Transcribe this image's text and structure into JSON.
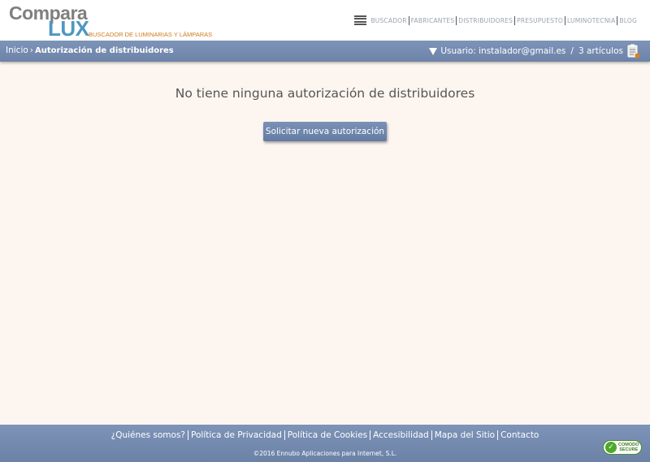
{
  "header": {
    "logo": {
      "compara": "Compara",
      "lux": "LUX",
      "tagline": "BUSCADOR DE LUMINARIAS Y LÁMPARAS"
    },
    "nav": [
      {
        "label": "BUSCADOR"
      },
      {
        "label": "FABRICANTES"
      },
      {
        "label": "DISTRIBUIDORES"
      },
      {
        "label": "PRESUPUESTO"
      },
      {
        "label": "LUMINOTECNIA"
      },
      {
        "label": "BLOG"
      }
    ],
    "menu_icon": "hamburger-menu-icon"
  },
  "bar": {
    "breadcrumb": {
      "home": "Inicio",
      "separator": "›",
      "current": "Autorización de distribuidores"
    },
    "user": {
      "label": "Usuario: instalador@gmail.es",
      "separator": "/",
      "cart": "3 artículos"
    }
  },
  "main": {
    "message": "No tiene ninguna autorización de distribuidores",
    "button_label": "Solicitar nueva autorización"
  },
  "footer": {
    "links": [
      {
        "label": "¿Quiénes somos?"
      },
      {
        "label": "Política de Privacidad"
      },
      {
        "label": "Política de Cookies"
      },
      {
        "label": "Accesibilidad"
      },
      {
        "label": "Mapa del Sitio"
      },
      {
        "label": "Contacto"
      }
    ],
    "copyright": "©2016 Ennubo Aplicaciones para Internet, S.L.",
    "badge": {
      "line1": "COMODO",
      "line2": "SECURE"
    }
  },
  "colors": {
    "bar": "#7489ad",
    "lux_blue": "#4f97c2",
    "tagline_orange": "#d07a1c",
    "background": "#fdf6f0"
  }
}
